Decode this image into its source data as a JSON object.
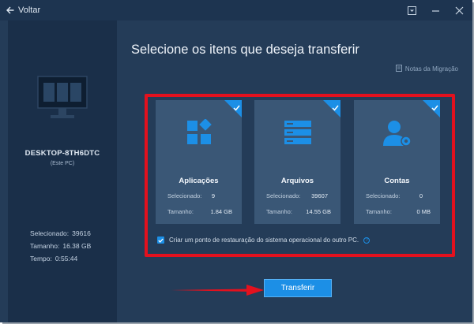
{
  "titlebar": {
    "back_label": "Voltar",
    "controls": [
      "dropdown-icon",
      "minimize-icon",
      "close-icon"
    ]
  },
  "sidebar": {
    "device_name": "DESKTOP-8TH6DTC",
    "device_sub": "(Este PC)",
    "stats": [
      {
        "label": "Selecionado:",
        "value": "39616"
      },
      {
        "label": "Tamanho:",
        "value": "16.38 GB"
      },
      {
        "label": "Tempo:",
        "value": "0:55:44"
      }
    ]
  },
  "main": {
    "title": "Selecione os itens que deseja transferir",
    "notes_link": "Notas da Migração",
    "cards": [
      {
        "icon": "apps-icon",
        "title": "Aplicações",
        "selected_label": "Selecionado:",
        "selected_value": "9",
        "size_label": "Tamanho:",
        "size_value": "1.84 GB",
        "checked": true
      },
      {
        "icon": "files-icon",
        "title": "Arquivos",
        "selected_label": "Selecionado:",
        "selected_value": "39607",
        "size_label": "Tamanho:",
        "size_value": "14.55 GB",
        "checked": true
      },
      {
        "icon": "accounts-icon",
        "title": "Contas",
        "selected_label": "Selecionado:",
        "selected_value": "0",
        "size_label": "Tamanho:",
        "size_value": "0 MB",
        "checked": true
      }
    ],
    "restore_point_label": "Criar um ponto de restauração do sistema operacional do outro PC.",
    "restore_point_checked": true,
    "transfer_button": "Transferir"
  },
  "colors": {
    "accent": "#1c8fe6",
    "highlight": "#e3111e",
    "card_bg": "#3a5776",
    "window_bg": "#243c58"
  }
}
